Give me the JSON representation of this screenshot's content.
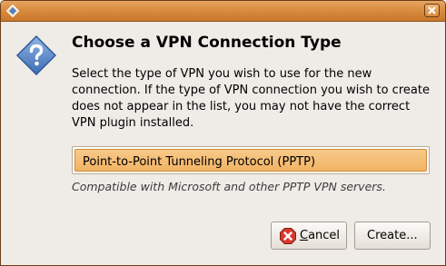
{
  "window": {
    "title": ""
  },
  "icons": {
    "title_icon": "app-diamond-icon",
    "close_icon": "close-icon",
    "dialog_icon": "question-icon",
    "cancel_icon": "cancel-icon"
  },
  "dialog": {
    "heading": "Choose a VPN Connection Type",
    "message": "Select the type of VPN you wish to use for the new connection.  If the type of VPN connection you wish to create does not appear in the list, you may not have the correct VPN plugin installed.",
    "selected_type": "Point-to-Point Tunneling Protocol (PPTP)",
    "type_description": "Compatible with Microsoft and other PPTP VPN servers."
  },
  "buttons": {
    "cancel_mnemonic": "C",
    "cancel_rest": "ancel",
    "create_label": "Create..."
  },
  "colors": {
    "titlebar": "#d98d3f",
    "selection": "#f2b464",
    "question_icon": "#4f7fc2"
  }
}
